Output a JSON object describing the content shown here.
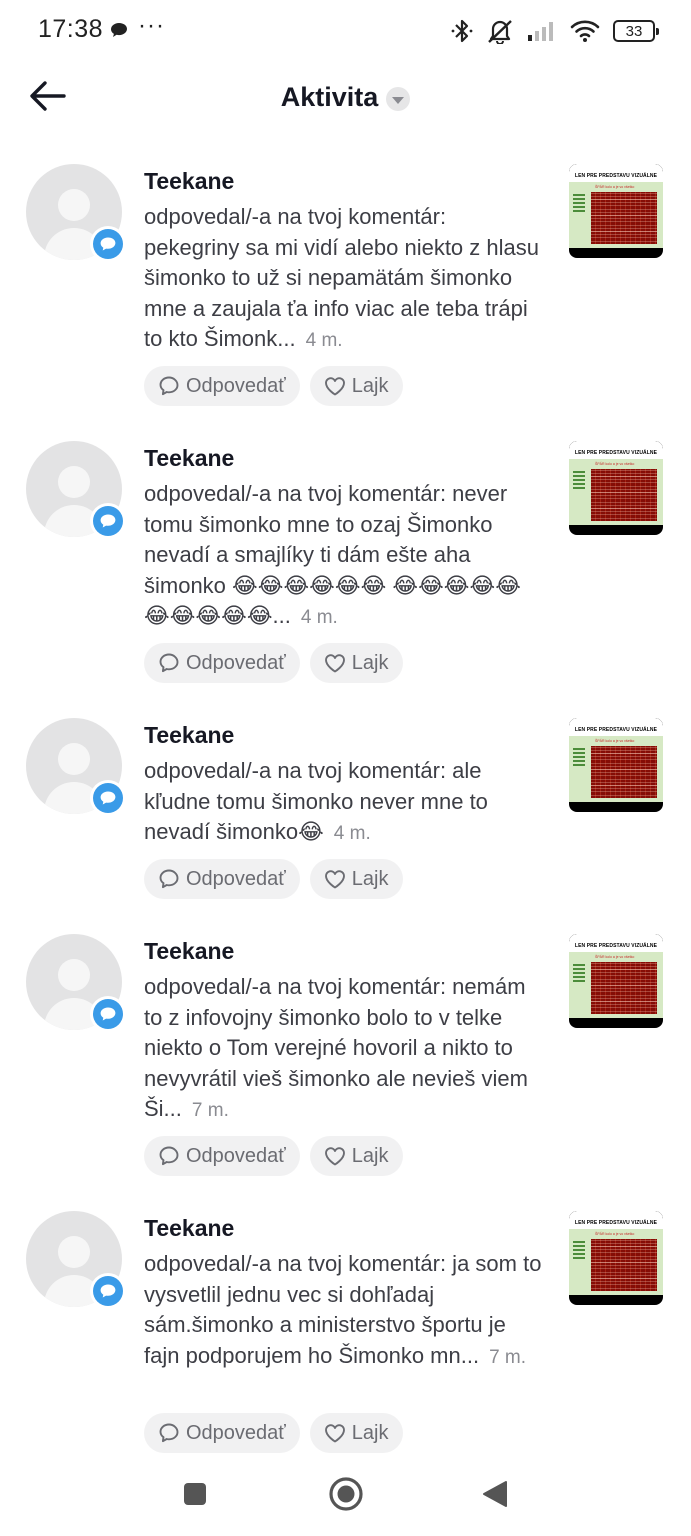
{
  "status_bar": {
    "time": "17:38",
    "dots": "···",
    "battery": "33",
    "icons": [
      "message-icon",
      "bluetooth-icon",
      "mute-icon",
      "signal-icon",
      "wifi-icon",
      "battery-icon"
    ]
  },
  "header": {
    "title": "Aktivita",
    "back_icon": "arrow-left-icon",
    "dropdown_icon": "chevron-down-icon"
  },
  "thumbnail_text": {
    "banner": "LEN PRE PREDSTAVU VIZUÁLNE",
    "sheet_title": "ŠPÁR kolo a je vo všetko"
  },
  "colors": {
    "badge_blue": "#3a9be8",
    "pill_bg": "#f1f1f2",
    "avatar_bg": "#e3e3e4",
    "text_primary": "#161823",
    "text_muted": "#8a8b91"
  },
  "items": [
    {
      "username": "Teekane",
      "comment": "odpovedal/-a na tvoj komentár: pekegriny sa mi vidí alebo niekto z hlasu šimonko to už si nepamätám šimonko mne a zaujala ťa info viac ale teba trápi to kto Šimonk...",
      "time": "4 m.",
      "reply_label": "Odpovedať",
      "like_label": "Lajk"
    },
    {
      "username": "Teekane",
      "comment": "odpovedal/-a na tvoj komentár: never tomu šimonko mne to ozaj Šimonko nevadí a smajlíky ti dám ešte aha šimonko 😂😂😂😂😂😂 😂😂😂😂😂😂😂😂😂😂...",
      "time": "4 m.",
      "reply_label": "Odpovedať",
      "like_label": "Lajk"
    },
    {
      "username": "Teekane",
      "comment": "odpovedal/-a na tvoj komentár: ale kľudne tomu šimonko never mne to nevadí šimonko😂",
      "time": "4 m.",
      "reply_label": "Odpovedať",
      "like_label": "Lajk"
    },
    {
      "username": "Teekane",
      "comment": "odpovedal/-a na tvoj komentár: nemám to z infovojny šimonko bolo to v telke niekto o Tom verejné hovoril a nikto to nevyvrátil vieš šimonko ale nevieš viem Ši...",
      "time": "7 m.",
      "reply_label": "Odpovedať",
      "like_label": "Lajk"
    },
    {
      "username": "Teekane",
      "comment": "odpovedal/-a na tvoj komentár: ja som to vysvetlil jednu vec si dohľadaj sám.šimonko a ministerstvo športu je fajn podporujem ho Šimonko mn...",
      "time": "7 m.",
      "reply_label": "Odpovedať",
      "like_label": "Lajk"
    }
  ],
  "nav_bar": {
    "icons": [
      "recents-square-icon",
      "home-circle-icon",
      "back-triangle-icon"
    ]
  }
}
